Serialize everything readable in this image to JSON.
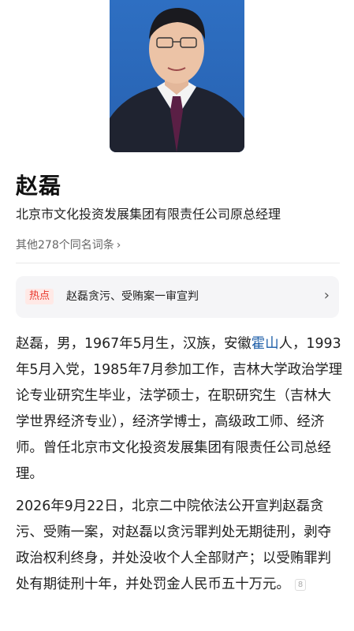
{
  "person": {
    "name": "赵磊",
    "title": "北京市文化投资发展集团有限责任公司原总经理",
    "same_name_link": "其他278个同名词条"
  },
  "hot": {
    "tag": "热点",
    "headline": "赵磊贪污、受贿案一审宣判"
  },
  "bio": {
    "p1_a": "赵磊，男，1967年5月生，汉族，安徽",
    "p1_link": "霍山",
    "p1_b": "人，1993年5月入党，1985年7月参加工作，吉林大学政治学理论专业研究生毕业，法学硕士，在职研究生（吉林大学世界经济专业），经济学博士，高级政工师、经济师。曾任北京市文化投资发展集团有限责任公司总经理。",
    "p2": "2026年9月22日，北京二中院依法公开宣判赵磊贪污、受贿一案，对赵磊以贪污罪判处无期徒刑，剥夺政治权利终身，并处没收个人全部财产；以受贿罪判处有期徒刑十年，并处罚金人民币五十万元。",
    "ref_num": "8"
  },
  "icons": {
    "samename_chevron": "chevron-right-icon",
    "hot_arrow": "chevron-right-icon"
  }
}
